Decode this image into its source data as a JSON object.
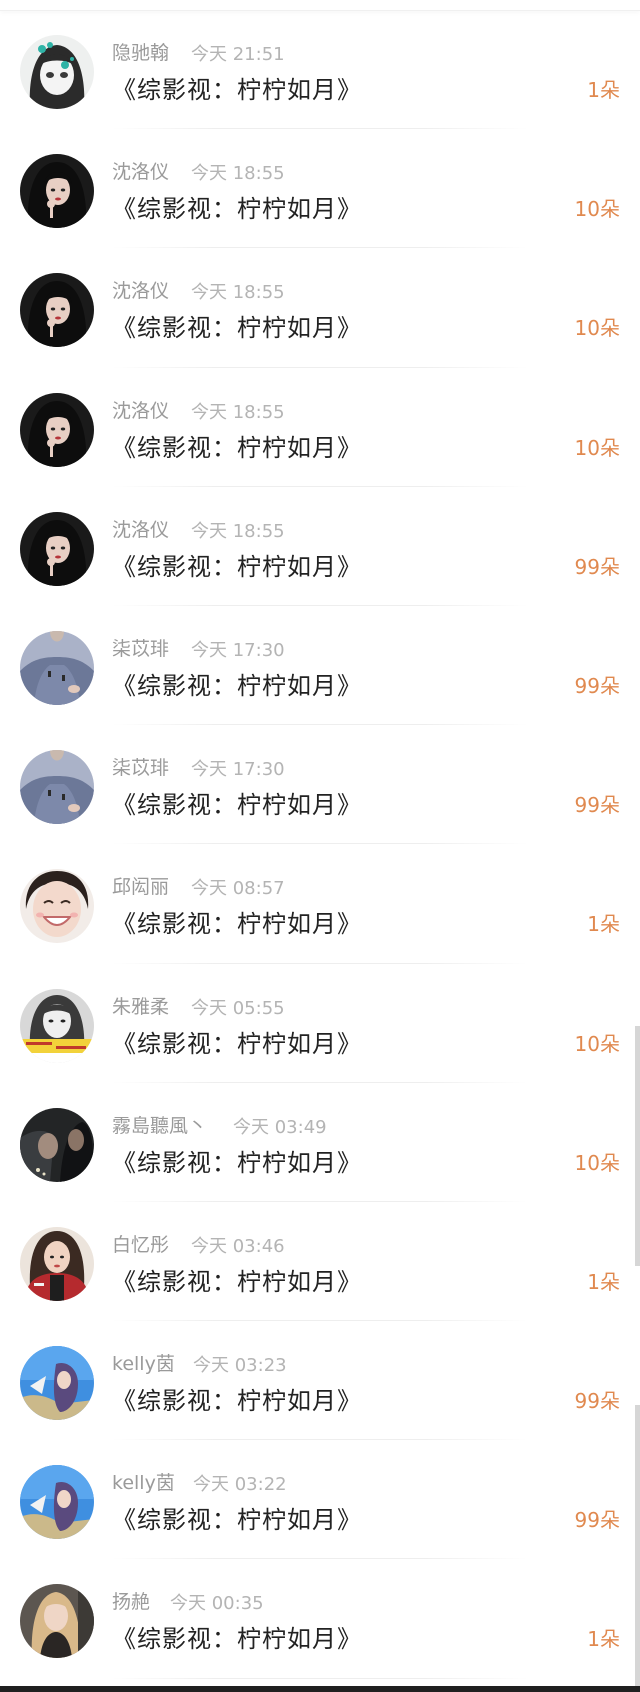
{
  "items": [
    {
      "name": "隐驰翰",
      "time": "今天 21:51",
      "title": "《综影视：柠柠如月》",
      "count": "1朵",
      "avatar": "anime-girl-light"
    },
    {
      "name": "沈洛仪",
      "time": "今天 18:55",
      "title": "《综影视：柠柠如月》",
      "count": "10朵",
      "avatar": "dark-hair-girl"
    },
    {
      "name": "沈洛仪",
      "time": "今天 18:55",
      "title": "《综影视：柠柠如月》",
      "count": "10朵",
      "avatar": "dark-hair-girl"
    },
    {
      "name": "沈洛仪",
      "time": "今天 18:55",
      "title": "《综影视：柠柠如月》",
      "count": "10朵",
      "avatar": "dark-hair-girl"
    },
    {
      "name": "沈洛仪",
      "time": "今天 18:55",
      "title": "《综影视：柠柠如月》",
      "count": "99朵",
      "avatar": "dark-hair-girl"
    },
    {
      "name": "柒苡琲",
      "time": "今天 17:30",
      "title": "《综影视：柠柠如月》",
      "count": "99朵",
      "avatar": "blue-sweater"
    },
    {
      "name": "柒苡琲",
      "time": "今天 17:30",
      "title": "《综影视：柠柠如月》",
      "count": "99朵",
      "avatar": "blue-sweater"
    },
    {
      "name": "邱闳丽",
      "time": "今天 08:57",
      "title": "《综影视：柠柠如月》",
      "count": "1朵",
      "avatar": "smiling-face"
    },
    {
      "name": "朱雅柔",
      "time": "今天 05:55",
      "title": "《综影视：柠柠如月》",
      "count": "10朵",
      "avatar": "bw-girl-yellow-banner"
    },
    {
      "name": "霧島聽風丶",
      "time": "今天 03:49",
      "title": "《综影视：柠柠如月》",
      "count": "10朵",
      "avatar": "dark-couple"
    },
    {
      "name": "白忆彤",
      "time": "今天 03:46",
      "title": "《综影视：柠柠如月》",
      "count": "1朵",
      "avatar": "girl-red-jacket"
    },
    {
      "name": "kelly茵",
      "time": "今天 03:23",
      "title": "《综影视：柠柠如月》",
      "count": "99朵",
      "avatar": "blue-sky-girl"
    },
    {
      "name": "kelly茵",
      "time": "今天 03:22",
      "title": "《综影视：柠柠如月》",
      "count": "99朵",
      "avatar": "blue-sky-girl"
    },
    {
      "name": "扬赩",
      "time": "今天 00:35",
      "title": "《综影视：柠柠如月》",
      "count": "1朵",
      "avatar": "blonde-girl"
    }
  ],
  "colors": {
    "count": "#e0894f",
    "name": "#9a9a9a",
    "time": "#b4b4b4",
    "title": "#222222"
  }
}
